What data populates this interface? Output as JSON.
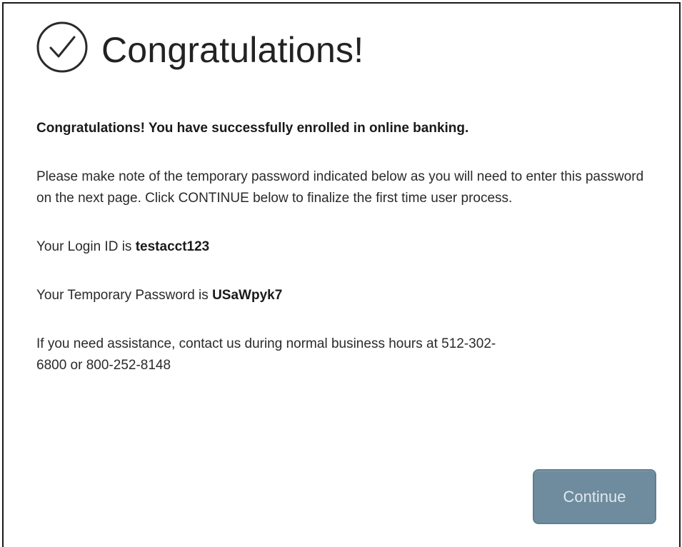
{
  "header": {
    "title": "Congratulations!",
    "icon": "check-circle-icon"
  },
  "content": {
    "lead": "Congratulations! You have successfully enrolled in online banking.",
    "instructions": "Please make note of the temporary password indicated below as you will need to enter this password on the next page. Click CONTINUE below to finalize the first time user process.",
    "login_prefix": "Your Login ID is ",
    "login_id": "testacct123",
    "password_prefix": "Your Temporary Password is ",
    "temp_password": "USaWpyk7",
    "assistance_line1": "If you need assistance, contact us during normal business hours at 512-302-",
    "assistance_line2": "6800 or 800-252-8148"
  },
  "actions": {
    "continue_label": "Continue"
  },
  "colors": {
    "button_bg": "#6f8c9e",
    "button_border": "#5e7f93",
    "button_text": "#dfe8ee",
    "text": "#222222"
  }
}
